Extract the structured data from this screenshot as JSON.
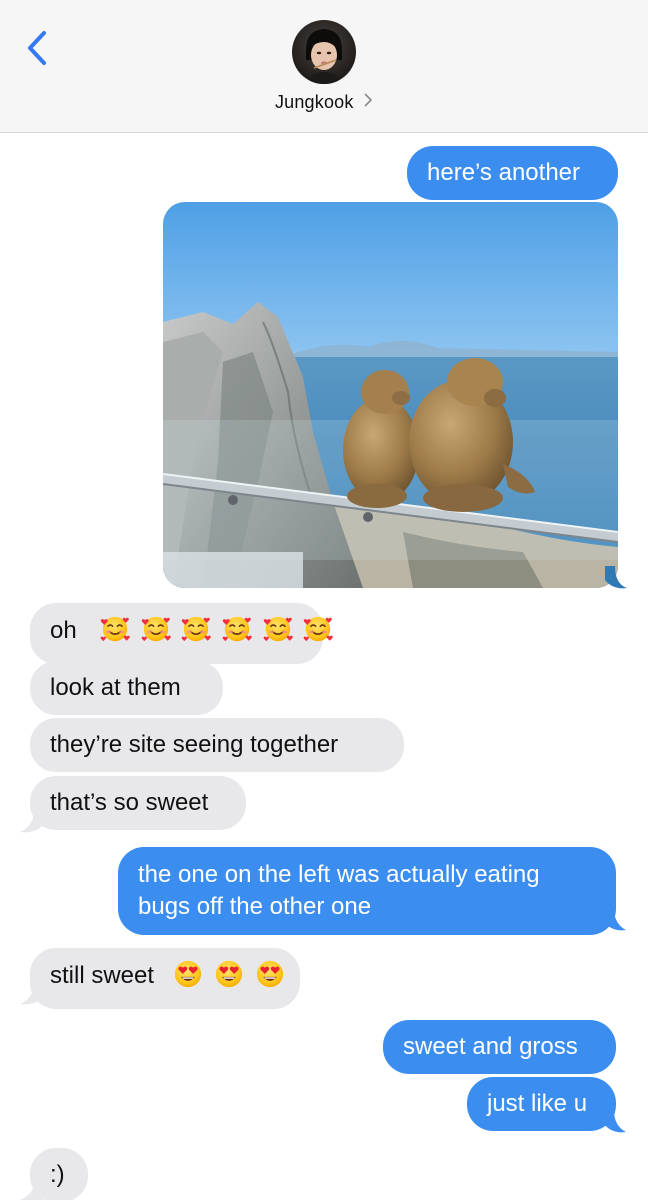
{
  "header": {
    "contact_name": "Jungkook",
    "back_icon": "chevron-left-icon",
    "chevron_icon": "chevron-right-icon"
  },
  "colors": {
    "outgoing_bubble": "#3b8ef0",
    "incoming_bubble": "#e8e8eb",
    "ios_blue": "#3478f6"
  },
  "messages": {
    "m1": {
      "direction": "outgoing",
      "text": "here’s another"
    },
    "m2": {
      "direction": "outgoing",
      "type": "photo",
      "description_icon": "photo-attachment"
    },
    "m3": {
      "direction": "incoming",
      "text": "oh",
      "emoji": [
        "smiling-face-with-hearts",
        "smiling-face-with-hearts",
        "smiling-face-with-hearts",
        "smiling-face-with-hearts",
        "smiling-face-with-hearts",
        "smiling-face-with-hearts"
      ]
    },
    "m4": {
      "direction": "incoming",
      "text": "look at them"
    },
    "m5": {
      "direction": "incoming",
      "text": "they’re site seeing together"
    },
    "m6": {
      "direction": "incoming",
      "text": "that’s so sweet"
    },
    "m7": {
      "direction": "outgoing",
      "line1": "the one on the left was actually eating",
      "line2": "bugs off the other one"
    },
    "m8": {
      "direction": "incoming",
      "text": "still sweet",
      "emoji": [
        "heart-eyes",
        "heart-eyes",
        "heart-eyes"
      ]
    },
    "m9": {
      "direction": "outgoing",
      "text": "sweet and gross"
    },
    "m10": {
      "direction": "outgoing",
      "text": "just like u"
    },
    "m11": {
      "direction": "incoming",
      "text": ":)"
    }
  }
}
